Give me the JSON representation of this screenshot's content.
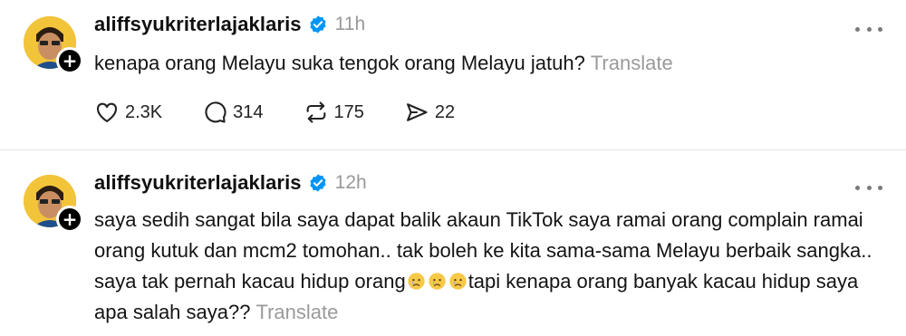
{
  "posts": [
    {
      "username": "aliffsyukriterlajaklaris",
      "time": "11h",
      "text": "kenapa orang Melayu suka tengok orang Melayu jatuh?",
      "translate": "Translate",
      "actions": {
        "likes": "2.3K",
        "replies": "314",
        "reposts": "175",
        "shares": "22"
      }
    },
    {
      "username": "aliffsyukriterlajaklaris",
      "time": "12h",
      "text_before_emoji": "saya sedih sangat bila saya dapat balik akaun TikTok saya ramai orang complain ramai orang kutuk dan mcm2 tomohan.. tak boleh ke kita sama-sama Melayu berbaik sangka.. saya tak pernah kacau hidup orang",
      "emojis": [
        "crying-face",
        "crying-face",
        "crying-face"
      ],
      "text_after_emoji": "tapi kenapa orang banyak kacau hidup saya apa salah saya??",
      "translate": "Translate"
    }
  ],
  "colors": {
    "verified": "#0095f6",
    "muted": "#999999",
    "divider": "#e3e3e3",
    "avatar_bg": "#f2c43a"
  }
}
